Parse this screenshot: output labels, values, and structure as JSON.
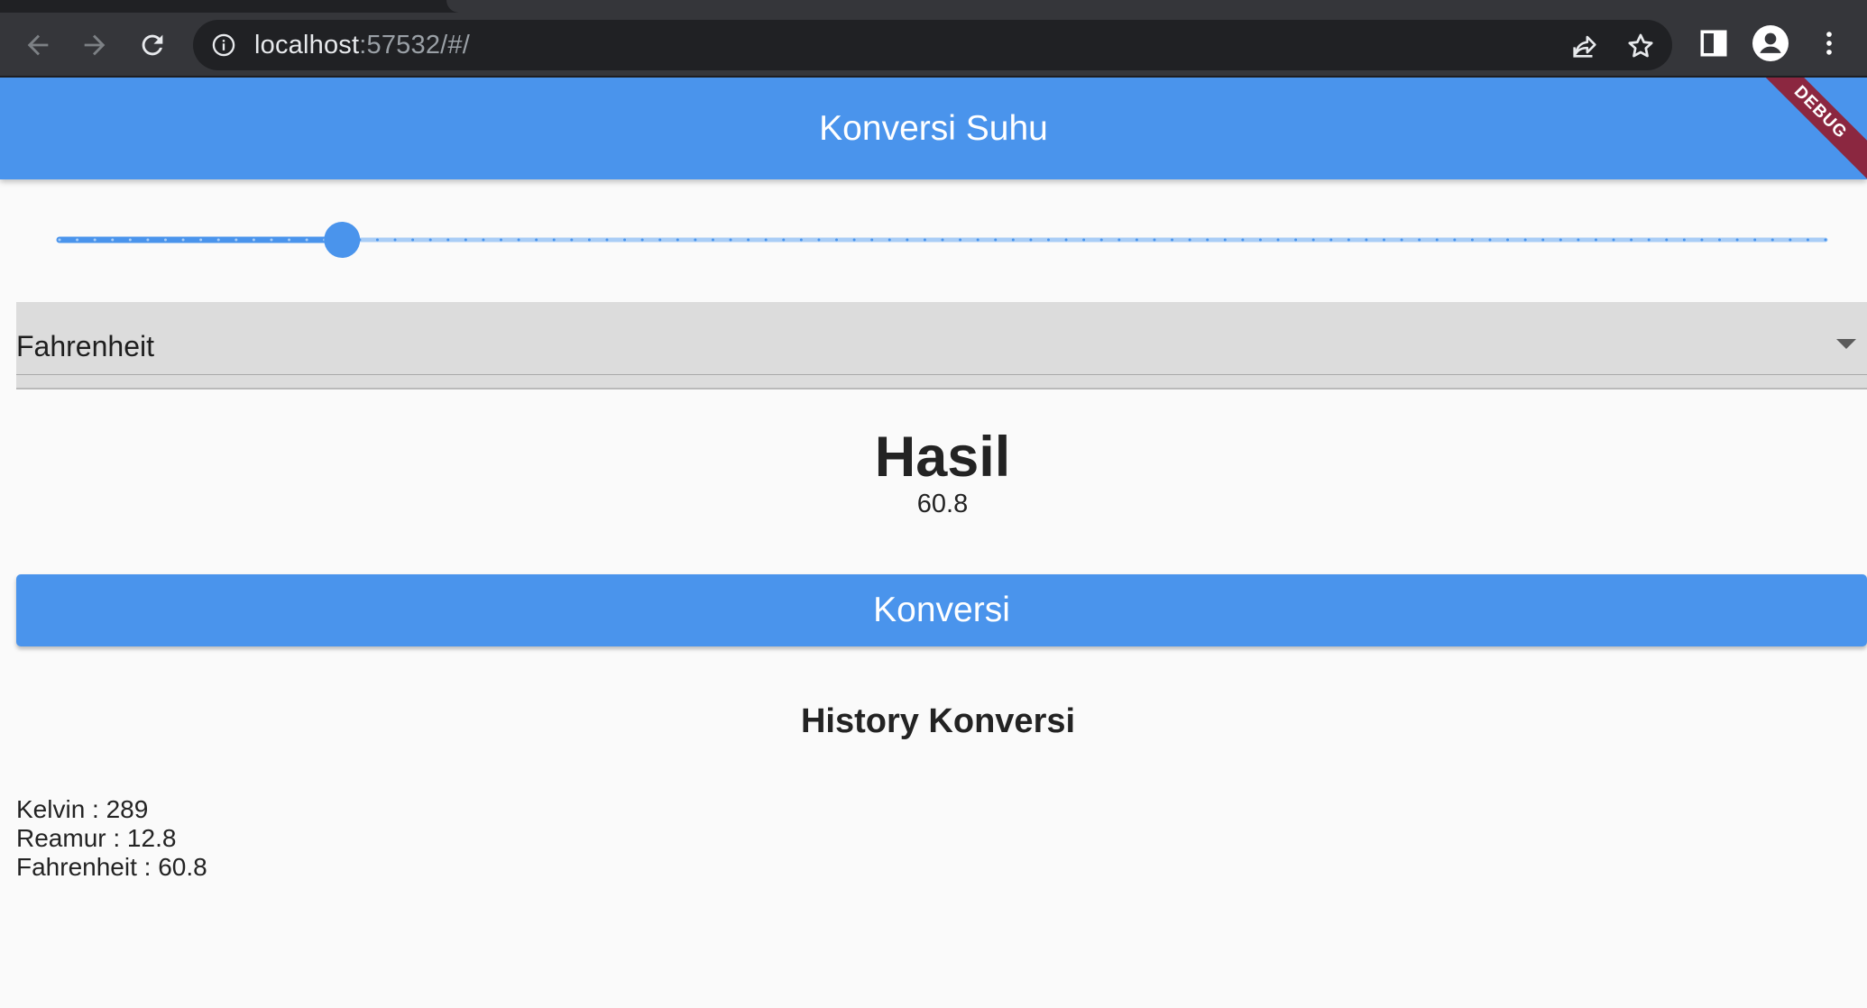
{
  "browser": {
    "url_host": "localhost",
    "url_rest": ":57532/#/",
    "icons": {
      "back": "back-arrow-icon",
      "forward": "forward-arrow-icon",
      "reload": "reload-icon",
      "info": "info-icon",
      "share": "share-icon",
      "bookmark": "star-icon",
      "sidepanel": "side-panel-icon",
      "profile": "profile-icon",
      "menu": "kebab-menu-icon"
    }
  },
  "app": {
    "title": "Konversi Suhu",
    "debug_banner": "DEBUG",
    "slider": {
      "value_fraction": 0.16,
      "divisions": 100,
      "active_color": "#4a94ec",
      "inactive_color": "#a9cdf6"
    },
    "dropdown": {
      "selected": "Fahrenheit"
    },
    "result": {
      "label": "Hasil",
      "value": "60.8"
    },
    "convert_button": "Konversi",
    "history": {
      "title": "History Konversi",
      "items": [
        "Kelvin : 289",
        "Reamur : 12.8",
        "Fahrenheit : 60.8"
      ]
    },
    "colors": {
      "primary": "#4a94ec",
      "background": "#fafafa",
      "dropdown_fill": "#dcdcdc"
    }
  }
}
